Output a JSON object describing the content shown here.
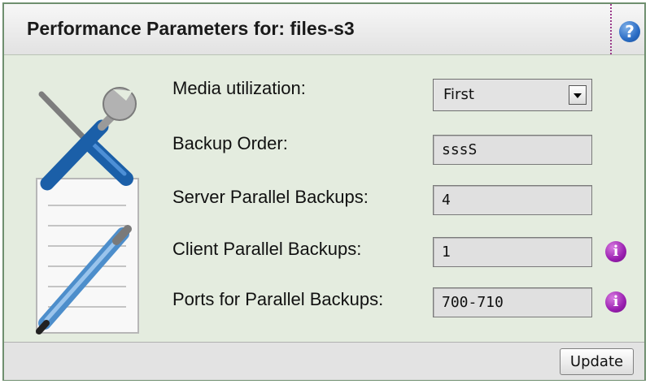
{
  "header": {
    "title": "Performance Parameters for: files-s3",
    "help_icon": "?"
  },
  "form": {
    "media_utilization": {
      "label": "Media utilization:",
      "value": "First"
    },
    "backup_order": {
      "label": "Backup Order:",
      "value": "sssS"
    },
    "server_parallel_backups": {
      "label": "Server Parallel Backups:",
      "value": "4"
    },
    "client_parallel_backups": {
      "label": "Client Parallel Backups:",
      "value": "1"
    },
    "ports_parallel_backups": {
      "label": "Ports for Parallel Backups:",
      "value": "700-710"
    }
  },
  "info_icon": "i",
  "footer": {
    "update_label": "Update"
  },
  "colors": {
    "panel_bg": "#e4ecdf",
    "border": "#6f8f6f",
    "help_icon": "#2a6cc4",
    "info_icon": "#9a1fb0"
  }
}
